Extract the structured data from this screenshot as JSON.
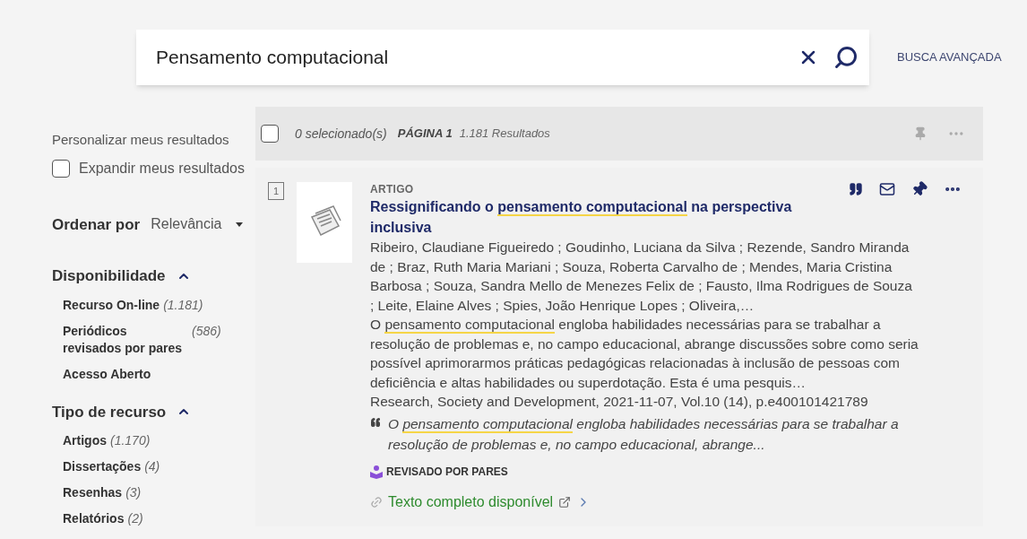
{
  "search": {
    "value": "Pensamento computacional",
    "advanced_link": "BUSCA AVANÇADA"
  },
  "sidebar": {
    "personalize_label": "Personalizar meus resultados",
    "expand": {
      "label": "Expandir meus resultados",
      "checked": false
    },
    "sort": {
      "label": "Ordenar por",
      "value": "Relevância"
    },
    "facets": [
      {
        "title": "Disponibilidade",
        "expanded": true,
        "items": [
          {
            "label": "Recurso On-line",
            "count": "(1.181)"
          },
          {
            "label": "Periódicos revisados por pares",
            "count": "(586)"
          },
          {
            "label": "Acesso Aberto"
          }
        ]
      },
      {
        "title": "Tipo de recurso",
        "expanded": true,
        "items": [
          {
            "label": "Artigos",
            "count": "(1.170)"
          },
          {
            "label": "Dissertações",
            "count": "(4)"
          },
          {
            "label": "Resenhas",
            "count": "(3)"
          },
          {
            "label": "Relatórios",
            "count": "(2)"
          }
        ]
      }
    ]
  },
  "results_bar": {
    "select_all_checked": false,
    "selected_count": "0 selecionado(s)",
    "page": "PÁGINA 1",
    "total": "1.181 Resultados"
  },
  "results": [
    {
      "number": "1",
      "selected": false,
      "type": "ARTIGO",
      "pinned": true,
      "title": {
        "before": "Ressignificando o ",
        "highlight": "pensamento computacional",
        "after": " na perspectiva inclusiva"
      },
      "authors": "Ribeiro, Claudiane Figueiredo ; Goudinho, Luciana da Silva ; Rezende, Sandro Miranda de ; Braz, Ruth Maria Mariani ; Souza, Roberta Carvalho de ; Mendes, Maria Cristina Barbosa ; Souza, Sandra Mello de Menezes Felix de ; Fausto, Ilma Rodrigues de Souza ; Leite, Elaine Alves ; Spies, João Henrique Lopes ; Oliveira,…",
      "abstract": {
        "before": "O ",
        "highlight": "pensamento computacional",
        "after": " engloba habilidades necessárias para se trabalhar a resolução de problemas e, no campo educacional, abrange discussões sobre como seria possível aprimorarmos práticas pedagógicas relacionadas à inclusão de pessoas com deficiência e altas habilidades ou superdotação. Esta é uma pesquis…"
      },
      "source": "Research, Society and Development, 2021-11-07, Vol.10 (14), p.e400101421789",
      "snippet": {
        "before": "O ",
        "highlight": "pensamento computacional",
        "after": " engloba habilidades necessárias para se trabalhar a resolução de problemas e, no campo educacional, abrange..."
      },
      "peer_reviewed": "REVISADO POR PARES",
      "fulltext_link": "Texto completo disponível"
    }
  ]
}
